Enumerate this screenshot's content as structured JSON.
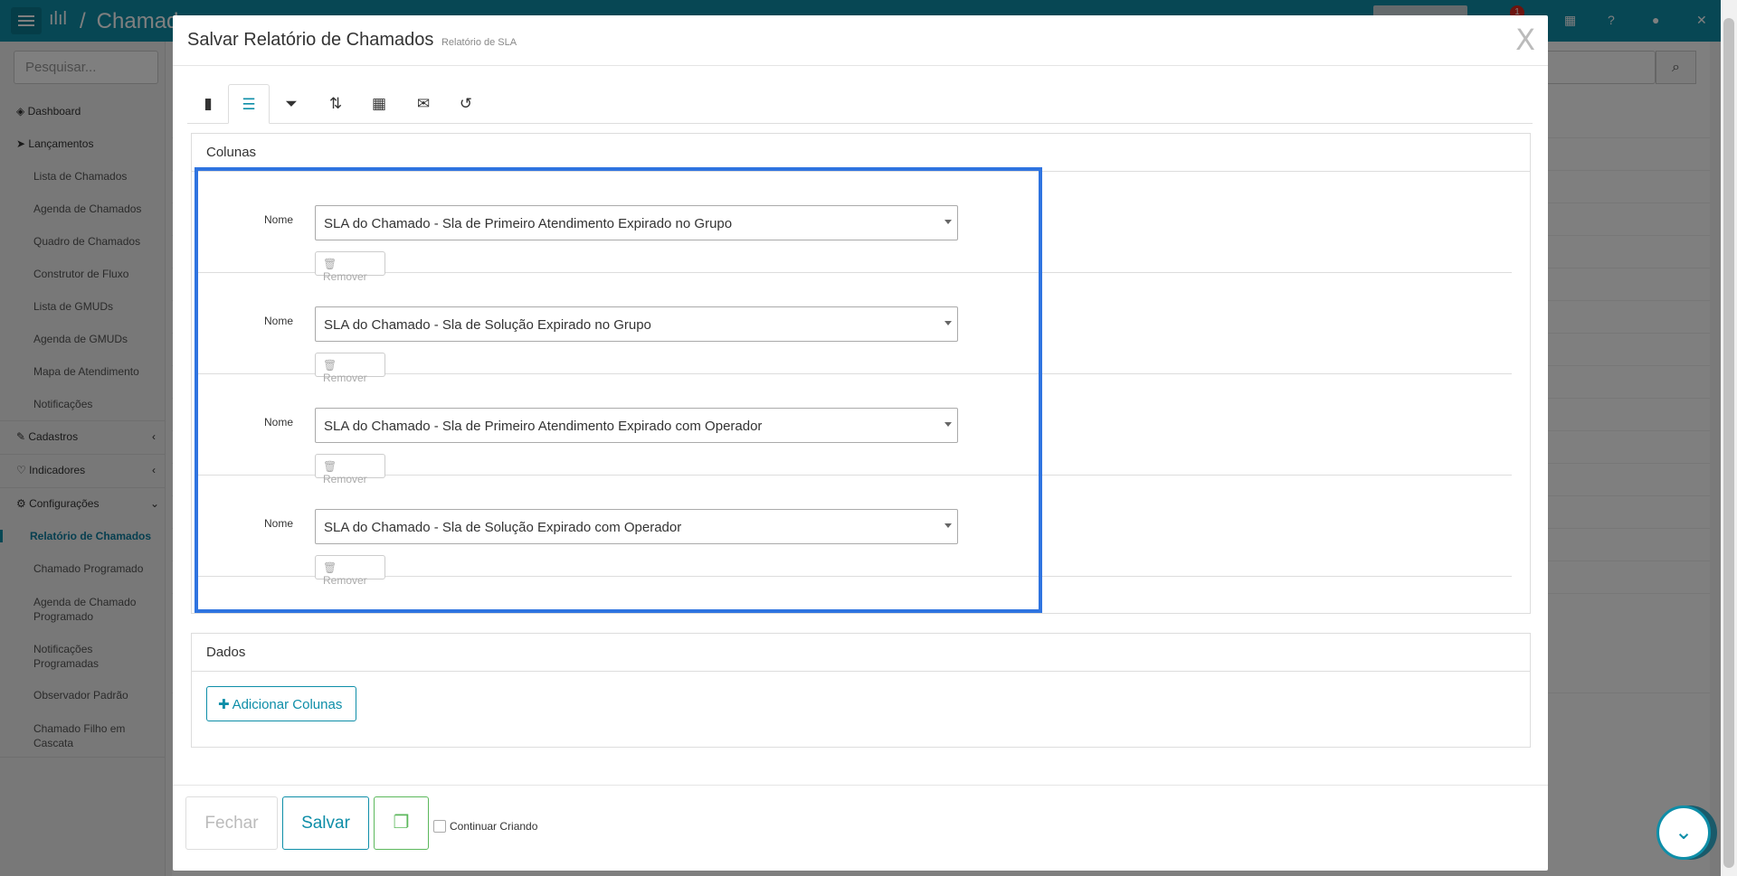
{
  "app": {
    "title": "Chamad",
    "notification_count": "1"
  },
  "sidebar": {
    "search_placeholder": "Pesquisar...",
    "items": [
      {
        "label": "Dashboard",
        "icon": "dashboard-icon"
      },
      {
        "label": "Lançamentos",
        "icon": "rocket-icon"
      },
      {
        "label": "Lista de Chamados"
      },
      {
        "label": "Agenda de Chamados"
      },
      {
        "label": "Quadro de Chamados"
      },
      {
        "label": "Construtor de Fluxo"
      },
      {
        "label": "Lista de GMUDs"
      },
      {
        "label": "Agenda de GMUDs"
      },
      {
        "label": "Mapa de Atendimento"
      },
      {
        "label": "Notificações"
      },
      {
        "label": "Cadastros",
        "icon": "edit-icon"
      },
      {
        "label": "Indicadores",
        "icon": "heart-icon"
      },
      {
        "label": "Configurações",
        "icon": "gear-icon"
      },
      {
        "label": "Relatório de Chamados",
        "active": true
      },
      {
        "label": "Chamado Programado"
      },
      {
        "label": "Agenda de Chamado Programado"
      },
      {
        "label": "Notificações Programadas"
      },
      {
        "label": "Observador Padrão"
      },
      {
        "label": "Chamado Filho em Cascata"
      }
    ]
  },
  "modal": {
    "title": "Salvar Relatório de Chamados",
    "subtitle": "Relatório de SLA",
    "close_label": "X",
    "tabs": [
      {
        "icon": "book-icon",
        "glyph": "▮"
      },
      {
        "icon": "list-icon",
        "glyph": "☰",
        "active": true
      },
      {
        "icon": "filter-icon",
        "glyph": "⏷"
      },
      {
        "icon": "sort-icon",
        "glyph": "⇅"
      },
      {
        "icon": "calendar-icon",
        "glyph": "▦"
      },
      {
        "icon": "envelope-icon",
        "glyph": "✉"
      },
      {
        "icon": "history-icon",
        "glyph": "↺"
      }
    ],
    "columns_panel": {
      "title": "Colunas",
      "rows": [
        {
          "label": "Nome",
          "value": "SLA do Chamado - Sla de Primeiro Atendimento Expirado no Grupo",
          "remove_label": "Remover"
        },
        {
          "label": "Nome",
          "value": "SLA do Chamado - Sla de Solução Expirado no Grupo",
          "remove_label": "Remover"
        },
        {
          "label": "Nome",
          "value": "SLA do Chamado - Sla de Primeiro Atendimento Expirado com Operador",
          "remove_label": "Remover"
        },
        {
          "label": "Nome",
          "value": "SLA do Chamado - Sla de Solução Expirado com Operador",
          "remove_label": "Remover"
        }
      ]
    },
    "data_panel": {
      "title": "Dados",
      "add_button_label": "Adicionar Colunas"
    },
    "footer": {
      "close_label": "Fechar",
      "save_label": "Salvar",
      "continue_label": "Continuar Criando",
      "continue_checked": false
    }
  },
  "colors": {
    "accent": "#0e8ea8",
    "highlight": "#2f74e0",
    "copy_button": "#5cb85c"
  }
}
